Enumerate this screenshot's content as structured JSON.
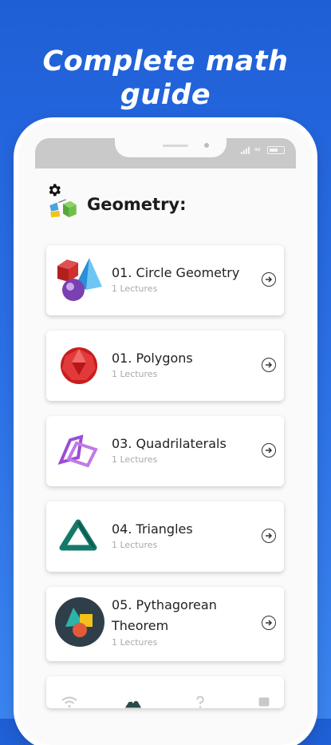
{
  "headline": {
    "line1": "Complete math",
    "line2": "guide"
  },
  "header": {
    "title": "Geometry:"
  },
  "lessons": [
    {
      "title": "01. Circle Geometry",
      "subtitle": "1 Lectures",
      "icon": "shapes-3d-icon"
    },
    {
      "title": "01. Polygons",
      "subtitle": "1 Lectures",
      "icon": "polygon-gem-icon"
    },
    {
      "title": "03. Quadrilaterals",
      "subtitle": "1 Lectures",
      "icon": "quadrilateral-frames-icon"
    },
    {
      "title": "04. Triangles",
      "subtitle": "1 Lectures",
      "icon": "triangle-ring-icon"
    },
    {
      "title": "05. Pythagorean Theorem",
      "subtitle": "1 Lectures",
      "icon": "pythagorean-shapes-icon"
    }
  ],
  "statusbar": {
    "network_label": "4G"
  },
  "nav": [
    "wifi-icon",
    "mountain-icon",
    "question-icon",
    "square-icon"
  ],
  "colors": {
    "background": "#2a6ee6",
    "card": "#ffffff",
    "title": "#1c1c1c"
  }
}
